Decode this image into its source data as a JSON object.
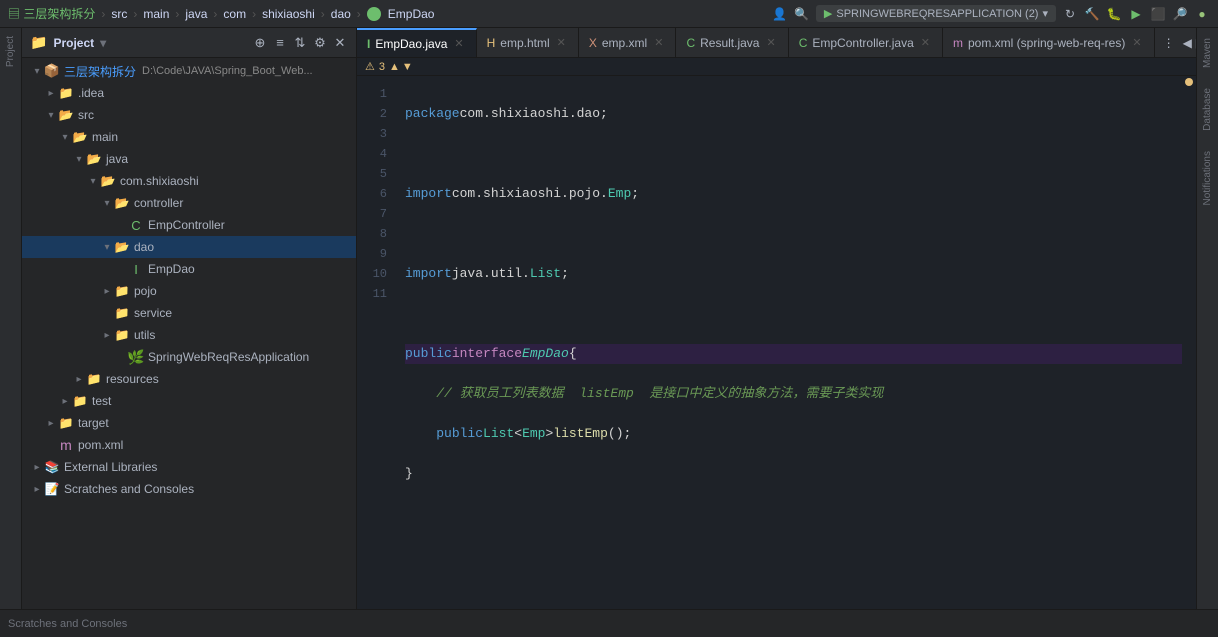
{
  "topbar": {
    "breadcrumb": [
      "三层架构拆分",
      "src",
      "main",
      "java",
      "com",
      "shixiaoshi",
      "dao",
      "EmpDao"
    ],
    "run_label": "SPRINGWEBREQRESAPPLICATION (2)",
    "project_label": "三层架构拆分"
  },
  "sidebar": {
    "title": "Project",
    "root_label": "三层架构拆分",
    "root_path": "D:\\Code\\JAVA\\Spring_Boot_Web...",
    "tree": [
      {
        "label": ".idea",
        "indent": 1,
        "type": "folder",
        "state": "closed"
      },
      {
        "label": "src",
        "indent": 1,
        "type": "folder",
        "state": "open"
      },
      {
        "label": "main",
        "indent": 2,
        "type": "folder",
        "state": "open"
      },
      {
        "label": "java",
        "indent": 3,
        "type": "folder",
        "state": "open"
      },
      {
        "label": "com.shixiaoshi",
        "indent": 4,
        "type": "folder",
        "state": "open"
      },
      {
        "label": "controller",
        "indent": 5,
        "type": "folder",
        "state": "open"
      },
      {
        "label": "EmpController",
        "indent": 6,
        "type": "java-interface"
      },
      {
        "label": "dao",
        "indent": 5,
        "type": "folder",
        "state": "open",
        "selected": true
      },
      {
        "label": "EmpDao",
        "indent": 6,
        "type": "java-interface"
      },
      {
        "label": "pojo",
        "indent": 5,
        "type": "folder",
        "state": "closed"
      },
      {
        "label": "service",
        "indent": 5,
        "type": "folder",
        "state": "leaf"
      },
      {
        "label": "utils",
        "indent": 5,
        "type": "folder",
        "state": "closed"
      },
      {
        "label": "SpringWebReqResApplication",
        "indent": 6,
        "type": "spring"
      },
      {
        "label": "resources",
        "indent": 3,
        "type": "folder",
        "state": "closed"
      },
      {
        "label": "test",
        "indent": 2,
        "type": "folder",
        "state": "closed"
      },
      {
        "label": "target",
        "indent": 1,
        "type": "folder",
        "state": "closed"
      },
      {
        "label": "pom.xml",
        "indent": 1,
        "type": "pom"
      }
    ],
    "external_libraries": "External Libraries",
    "scratches": "Scratches and Consoles"
  },
  "tabs": [
    {
      "label": "EmpDao.java",
      "type": "java",
      "active": true,
      "closeable": true
    },
    {
      "label": "emp.html",
      "type": "html",
      "active": false,
      "closeable": true
    },
    {
      "label": "emp.xml",
      "type": "xml",
      "active": false,
      "closeable": true
    },
    {
      "label": "Result.java",
      "type": "java",
      "active": false,
      "closeable": true
    },
    {
      "label": "EmpController.java",
      "type": "java",
      "active": false,
      "closeable": true
    },
    {
      "label": "pom.xml (spring-web-req-res)",
      "type": "pom",
      "active": false,
      "closeable": true
    }
  ],
  "editor": {
    "filename": "EmpDao.java",
    "warning_count": "3",
    "lines": [
      {
        "num": 1,
        "content": "package com.shixiaoshi.dao;",
        "highlighted": false
      },
      {
        "num": 2,
        "content": "",
        "highlighted": false
      },
      {
        "num": 3,
        "content": "import com.shixiaoshi.pojo.Emp;",
        "highlighted": false
      },
      {
        "num": 4,
        "content": "",
        "highlighted": false
      },
      {
        "num": 5,
        "content": "import java.util.List;",
        "highlighted": false
      },
      {
        "num": 6,
        "content": "",
        "highlighted": false
      },
      {
        "num": 7,
        "content": "public interface EmpDao {",
        "highlighted": true
      },
      {
        "num": 8,
        "content": "    // 获取员工列表数据  listEmp  是接口中定义的抽象方法，需要子类实现",
        "highlighted": false
      },
      {
        "num": 9,
        "content": "    public List<Emp> listEmp();",
        "highlighted": false
      },
      {
        "num": 10,
        "content": "}",
        "highlighted": false
      },
      {
        "num": 11,
        "content": "",
        "highlighted": false
      }
    ]
  },
  "right_sidebar": {
    "items": [
      "Maven",
      "Database",
      "Notifications"
    ]
  },
  "left_strip": {
    "items": [
      "Project"
    ]
  },
  "bottom": {
    "scratches_label": "Scratches and Consoles"
  }
}
